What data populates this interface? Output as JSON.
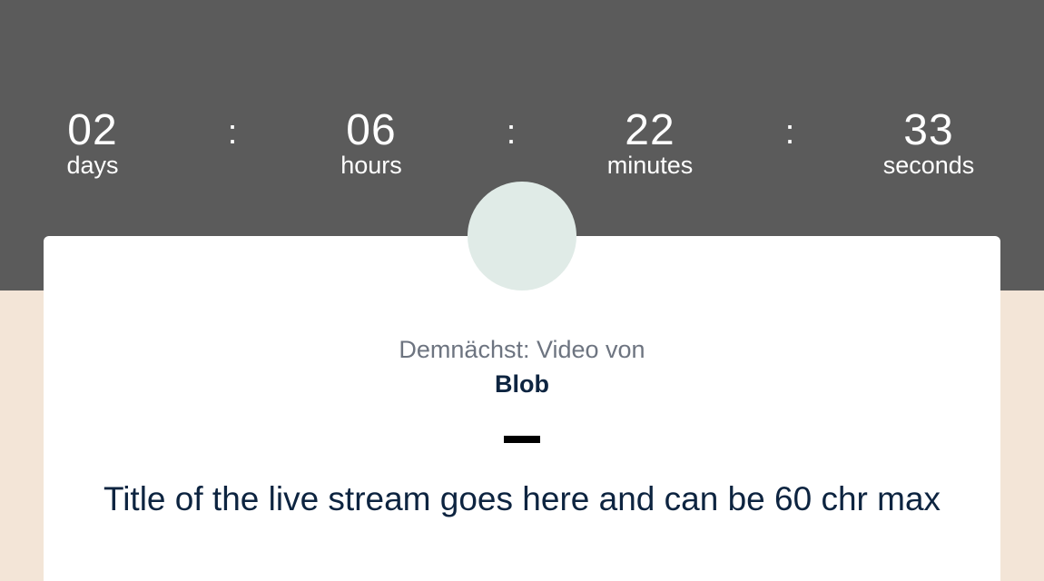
{
  "countdown": {
    "days": {
      "value": "02",
      "label": "days"
    },
    "hours": {
      "value": "06",
      "label": "hours"
    },
    "minutes": {
      "value": "22",
      "label": "minutes"
    },
    "seconds": {
      "value": "33",
      "label": "seconds"
    },
    "separator": ":"
  },
  "card": {
    "coming_label": "Demnächst: Video von",
    "creator_name": "Blob",
    "title": "Title of the live stream goes here and can be 60 chr max"
  },
  "colors": {
    "header_background": "#5b5b5b",
    "page_background": "#f3e5d7",
    "card_background": "#ffffff",
    "avatar_placeholder": "#e0ebe7",
    "heading_text": "#0d2440",
    "muted_text": "#6d7480"
  }
}
